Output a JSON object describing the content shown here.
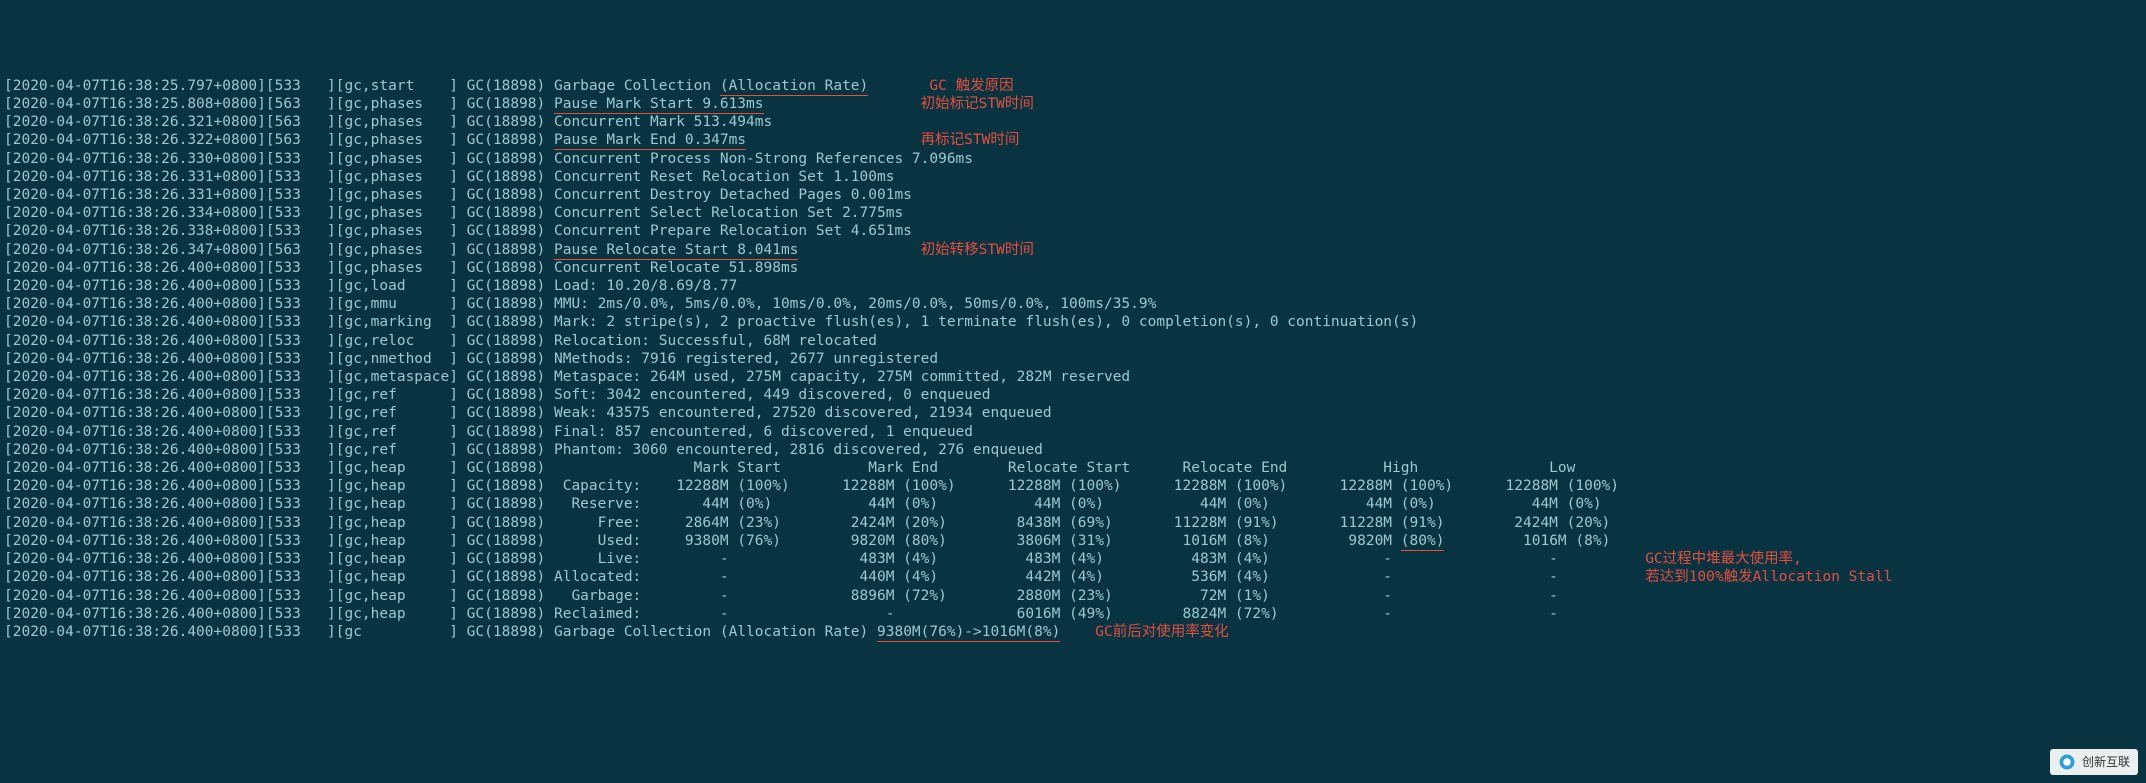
{
  "lines": [
    {
      "ts": "[2020-04-07T16:38:25.797+0800][533   ]",
      "tag": "[gc,start    ]",
      "gcid": " GC(18898) ",
      "plain": "Garbage Collection ",
      "ul": "(Allocation Rate)",
      "after": "",
      "ann": "       GC 触发原因"
    },
    {
      "ts": "[2020-04-07T16:38:25.808+0800][563   ]",
      "tag": "[gc,phases   ]",
      "gcid": " GC(18898) ",
      "ul": "Pause Mark Start 9.613ms",
      "after": "",
      "ann": "                  初始标记STW时间"
    },
    {
      "ts": "[2020-04-07T16:38:26.321+0800][563   ]",
      "tag": "[gc,phases   ]",
      "gcid": " GC(18898) ",
      "plain": "Concurrent Mark 513.494ms"
    },
    {
      "ts": "[2020-04-07T16:38:26.322+0800][563   ]",
      "tag": "[gc,phases   ]",
      "gcid": " GC(18898) ",
      "ul": "Pause Mark End 0.347ms",
      "after": "",
      "ann": "                    再标记STW时间"
    },
    {
      "ts": "[2020-04-07T16:38:26.330+0800][533   ]",
      "tag": "[gc,phases   ]",
      "gcid": " GC(18898) ",
      "plain": "Concurrent Process Non-Strong References 7.096ms"
    },
    {
      "ts": "[2020-04-07T16:38:26.331+0800][533   ]",
      "tag": "[gc,phases   ]",
      "gcid": " GC(18898) ",
      "plain": "Concurrent Reset Relocation Set 1.100ms"
    },
    {
      "ts": "[2020-04-07T16:38:26.331+0800][533   ]",
      "tag": "[gc,phases   ]",
      "gcid": " GC(18898) ",
      "plain": "Concurrent Destroy Detached Pages 0.001ms"
    },
    {
      "ts": "[2020-04-07T16:38:26.334+0800][533   ]",
      "tag": "[gc,phases   ]",
      "gcid": " GC(18898) ",
      "plain": "Concurrent Select Relocation Set 2.775ms"
    },
    {
      "ts": "[2020-04-07T16:38:26.338+0800][533   ]",
      "tag": "[gc,phases   ]",
      "gcid": " GC(18898) ",
      "plain": "Concurrent Prepare Relocation Set 4.651ms"
    },
    {
      "ts": "[2020-04-07T16:38:26.347+0800][563   ]",
      "tag": "[gc,phases   ]",
      "gcid": " GC(18898) ",
      "ul": "Pause Relocate Start 8.041ms",
      "after": "",
      "ann": "              初始转移STW时间"
    },
    {
      "ts": "[2020-04-07T16:38:26.400+0800][533   ]",
      "tag": "[gc,phases   ]",
      "gcid": " GC(18898) ",
      "plain": "Concurrent Relocate 51.898ms"
    },
    {
      "ts": "[2020-04-07T16:38:26.400+0800][533   ]",
      "tag": "[gc,load     ]",
      "gcid": " GC(18898) ",
      "plain": "Load: 10.20/8.69/8.77"
    },
    {
      "ts": "[2020-04-07T16:38:26.400+0800][533   ]",
      "tag": "[gc,mmu      ]",
      "gcid": " GC(18898) ",
      "plain": "MMU: 2ms/0.0%, 5ms/0.0%, 10ms/0.0%, 20ms/0.0%, 50ms/0.0%, 100ms/35.9%"
    },
    {
      "ts": "[2020-04-07T16:38:26.400+0800][533   ]",
      "tag": "[gc,marking  ]",
      "gcid": " GC(18898) ",
      "plain": "Mark: 2 stripe(s), 2 proactive flush(es), 1 terminate flush(es), 0 completion(s), 0 continuation(s)"
    },
    {
      "ts": "[2020-04-07T16:38:26.400+0800][533   ]",
      "tag": "[gc,reloc    ]",
      "gcid": " GC(18898) ",
      "plain": "Relocation: Successful, 68M relocated"
    },
    {
      "ts": "[2020-04-07T16:38:26.400+0800][533   ]",
      "tag": "[gc,nmethod  ]",
      "gcid": " GC(18898) ",
      "plain": "NMethods: 7916 registered, 2677 unregistered"
    },
    {
      "ts": "[2020-04-07T16:38:26.400+0800][533   ]",
      "tag": "[gc,metaspace]",
      "gcid": " GC(18898) ",
      "plain": "Metaspace: 264M used, 275M capacity, 275M committed, 282M reserved"
    },
    {
      "ts": "[2020-04-07T16:38:26.400+0800][533   ]",
      "tag": "[gc,ref      ]",
      "gcid": " GC(18898) ",
      "plain": "Soft: 3042 encountered, 449 discovered, 0 enqueued"
    },
    {
      "ts": "[2020-04-07T16:38:26.400+0800][533   ]",
      "tag": "[gc,ref      ]",
      "gcid": " GC(18898) ",
      "plain": "Weak: 43575 encountered, 27520 discovered, 21934 enqueued"
    },
    {
      "ts": "[2020-04-07T16:38:26.400+0800][533   ]",
      "tag": "[gc,ref      ]",
      "gcid": " GC(18898) ",
      "plain": "Final: 857 encountered, 6 discovered, 1 enqueued"
    },
    {
      "ts": "[2020-04-07T16:38:26.400+0800][533   ]",
      "tag": "[gc,ref      ]",
      "gcid": " GC(18898) ",
      "plain": "Phantom: 3060 encountered, 2816 discovered, 276 enqueued"
    },
    {
      "ts": "[2020-04-07T16:38:26.400+0800][533   ]",
      "tag": "[gc,heap     ]",
      "gcid": " GC(18898) ",
      "plain": "                Mark Start          Mark End        Relocate Start      Relocate End           High               Low"
    },
    {
      "ts": "[2020-04-07T16:38:26.400+0800][533   ]",
      "tag": "[gc,heap     ]",
      "gcid": " GC(18898) ",
      "plain": " Capacity:    12288M (100%)      12288M (100%)      12288M (100%)      12288M (100%)      12288M (100%)      12288M (100%)"
    },
    {
      "ts": "[2020-04-07T16:38:26.400+0800][533   ]",
      "tag": "[gc,heap     ]",
      "gcid": " GC(18898) ",
      "plain": "  Reserve:       44M (0%)           44M (0%)           44M (0%)           44M (0%)           44M (0%)           44M (0%)"
    },
    {
      "ts": "[2020-04-07T16:38:26.400+0800][533   ]",
      "tag": "[gc,heap     ]",
      "gcid": " GC(18898) ",
      "plain": "     Free:     2864M (23%)        2424M (20%)        8438M (69%)       11228M (91%)       11228M (91%)        2424M (20%)"
    },
    {
      "ts": "[2020-04-07T16:38:26.400+0800][533   ]",
      "tag": "[gc,heap     ]",
      "gcid": " GC(18898) ",
      "plain": "     Used:     9380M (76%)        9820M (80%)        3806M (31%)        1016M (8%)         9820M ",
      "ul": "(80%)",
      "after": "         1016M (8%)"
    },
    {
      "ts": "[2020-04-07T16:38:26.400+0800][533   ]",
      "tag": "[gc,heap     ]",
      "gcid": " GC(18898) ",
      "plain": "     Live:         -               483M (4%)          483M (4%)          483M (4%)             -                  -",
      "ann": "          GC过程中堆最大使用率,"
    },
    {
      "ts": "[2020-04-07T16:38:26.400+0800][533   ]",
      "tag": "[gc,heap     ]",
      "gcid": " GC(18898) ",
      "plain": "Allocated:         -               440M (4%)          442M (4%)          536M (4%)             -                  -",
      "ann": "          若达到100%触发Allocation Stall"
    },
    {
      "ts": "[2020-04-07T16:38:26.400+0800][533   ]",
      "tag": "[gc,heap     ]",
      "gcid": " GC(18898) ",
      "plain": "  Garbage:         -              8896M (72%)        2880M (23%)          72M (1%)             -                  -"
    },
    {
      "ts": "[2020-04-07T16:38:26.400+0800][533   ]",
      "tag": "[gc,heap     ]",
      "gcid": " GC(18898) ",
      "plain": "Reclaimed:         -                  -              6016M (49%)        8824M (72%)            -                  -"
    },
    {
      "ts": "[2020-04-07T16:38:26.400+0800][533   ]",
      "tag": "[gc          ]",
      "gcid": " GC(18898) ",
      "plain": "Garbage Collection (Allocation Rate) ",
      "ul": "9380M(76%)->1016M(8%)",
      "after": "",
      "ann": "    GC前后对使用率变化"
    }
  ],
  "watermark": "创新互联"
}
